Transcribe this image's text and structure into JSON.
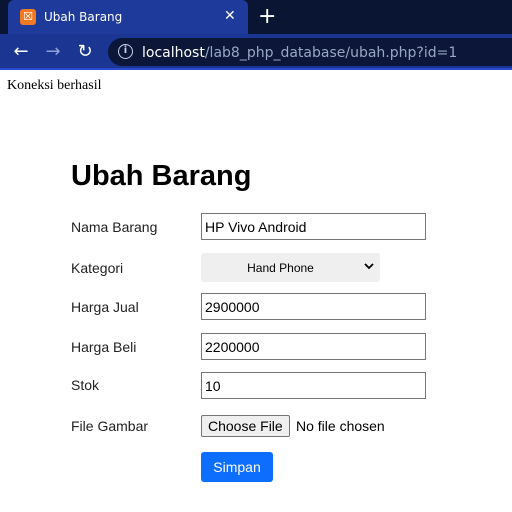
{
  "browser": {
    "tab_title": "Ubah Barang",
    "tab_favicon_glyph": "☒",
    "tab_close_glyph": "✕",
    "new_tab_glyph": "+",
    "back_glyph": "←",
    "forward_glyph": "→",
    "reload_glyph": "↻",
    "info_glyph": "i",
    "url_host": "localhost",
    "url_path": "/lab8_php_database/ubah.php?id=1",
    "icons": {
      "favicon": "xampp-favicon-icon",
      "close": "close-icon",
      "new_tab": "plus-icon",
      "back": "arrow-left-icon",
      "forward": "arrow-right-icon",
      "reload": "reload-icon",
      "info": "info-icon"
    },
    "colors": {
      "tabstrip": "#0a1533",
      "tab": "#1e3a9a",
      "toolbar": "#1a3592",
      "omnibox": "#0b1638",
      "favicon": "#f07a22"
    }
  },
  "page": {
    "connection_message": "Koneksi berhasil",
    "heading": "Ubah Barang",
    "form": {
      "nama_label": "Nama Barang",
      "nama_value": "HP Vivo Android",
      "kategori_label": "Kategori",
      "kategori_value": "Hand Phone",
      "harga_jual_label": "Harga Jual",
      "harga_jual_value": "2900000",
      "harga_beli_label": "Harga Beli",
      "harga_beli_value": "2200000",
      "stok_label": "Stok",
      "stok_value": "10",
      "file_label": "File Gambar",
      "file_button": "Choose File",
      "file_status": "No file chosen",
      "submit_label": "Simpan"
    },
    "colors": {
      "submit_button": "#0d6efd",
      "select_background": "#efefef"
    }
  }
}
